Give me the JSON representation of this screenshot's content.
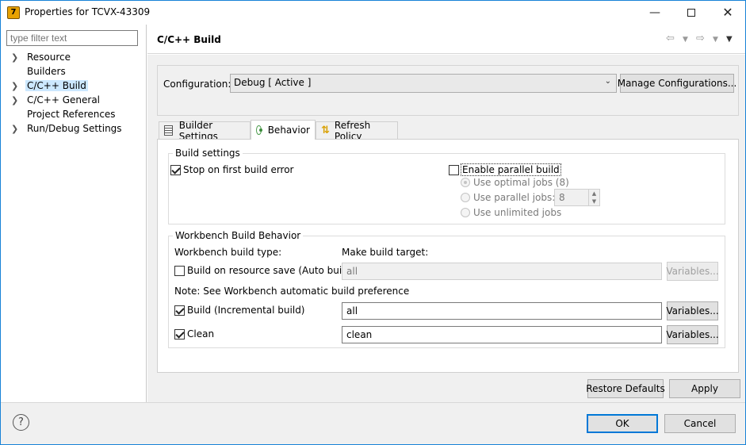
{
  "window": {
    "title": "Properties for TCVX-43309",
    "icon_letter": "7"
  },
  "sidebar": {
    "filter_placeholder": "type filter text",
    "items": [
      {
        "label": "Resource",
        "expandable": true
      },
      {
        "label": "Builders",
        "expandable": false
      },
      {
        "label": "C/C++ Build",
        "expandable": true,
        "selected": true
      },
      {
        "label": "C/C++ General",
        "expandable": true
      },
      {
        "label": "Project References",
        "expandable": false
      },
      {
        "label": "Run/Debug Settings",
        "expandable": true
      }
    ]
  },
  "header": {
    "title": "C/C++ Build"
  },
  "configuration": {
    "label": "Configuration:",
    "value": "Debug  [ Active ]",
    "manage_button": "Manage Configurations..."
  },
  "tabs": [
    {
      "label": "Builder Settings",
      "icon": "builder-settings-icon"
    },
    {
      "label": "Behavior",
      "icon": "behavior-icon",
      "active": true
    },
    {
      "label": "Refresh Policy",
      "icon": "refresh-policy-icon"
    }
  ],
  "build_settings": {
    "title": "Build settings",
    "stop_on_error": {
      "label": "Stop on first build error",
      "checked": true
    },
    "parallel": {
      "label": "Enable parallel build",
      "checked": false
    },
    "optimal_jobs": "Use optimal jobs (8)",
    "parallel_jobs": "Use parallel jobs:",
    "parallel_jobs_value": "8",
    "unlimited_jobs": "Use unlimited jobs"
  },
  "workbench": {
    "title": "Workbench Build Behavior",
    "type_label": "Workbench build type:",
    "target_label": "Make build target:",
    "auto_build": {
      "label": "Build on resource save (Auto build)",
      "checked": false,
      "target": "all"
    },
    "note": "Note: See Workbench automatic build preference",
    "incremental": {
      "label": "Build (Incremental build)",
      "checked": true,
      "target": "all"
    },
    "clean": {
      "label": "Clean",
      "checked": true,
      "target": "clean"
    },
    "variables_label": "Variables..."
  },
  "actions": {
    "restore_defaults": "Restore Defaults",
    "apply": "Apply",
    "ok": "OK",
    "cancel": "Cancel"
  }
}
